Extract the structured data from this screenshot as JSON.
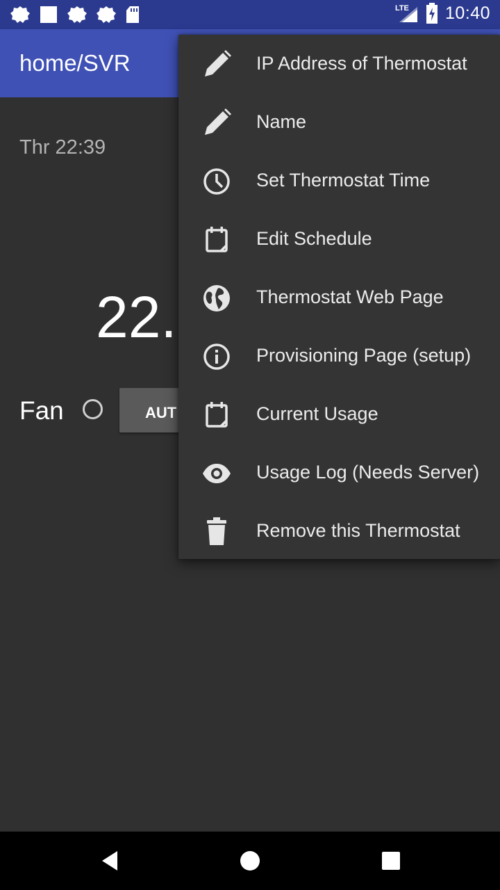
{
  "status_bar": {
    "network_label": "LTE",
    "time": "10:40",
    "notification_icons": [
      "cloud-icon",
      "square-icon",
      "cloud-icon",
      "cloud-icon",
      "sd-card-icon"
    ]
  },
  "app_bar": {
    "title": "home/SVR"
  },
  "main": {
    "day_time": "Thr 22:39",
    "temperature": "22.",
    "fan_label": "Fan",
    "fan_mode_button": "AUT"
  },
  "menu": {
    "items": [
      {
        "label": "IP Address of Thermostat",
        "icon": "pencil-icon"
      },
      {
        "label": "Name",
        "icon": "pencil-icon"
      },
      {
        "label": "Set Thermostat Time",
        "icon": "clock-icon"
      },
      {
        "label": "Edit Schedule",
        "icon": "calendar-icon"
      },
      {
        "label": "Thermostat Web Page",
        "icon": "globe-icon"
      },
      {
        "label": "Provisioning Page (setup)",
        "icon": "info-icon"
      },
      {
        "label": "Current Usage",
        "icon": "calendar-icon"
      },
      {
        "label": "Usage Log (Needs Server)",
        "icon": "eye-icon"
      },
      {
        "label": "Remove this Thermostat",
        "icon": "trash-icon"
      }
    ]
  },
  "nav_bar": {
    "buttons": [
      "back-icon",
      "home-icon",
      "recents-icon"
    ]
  },
  "colors": {
    "primary": "#3f51b5",
    "primary_dark": "#2b3a8f",
    "background": "#303030",
    "menu_background": "#343434"
  }
}
